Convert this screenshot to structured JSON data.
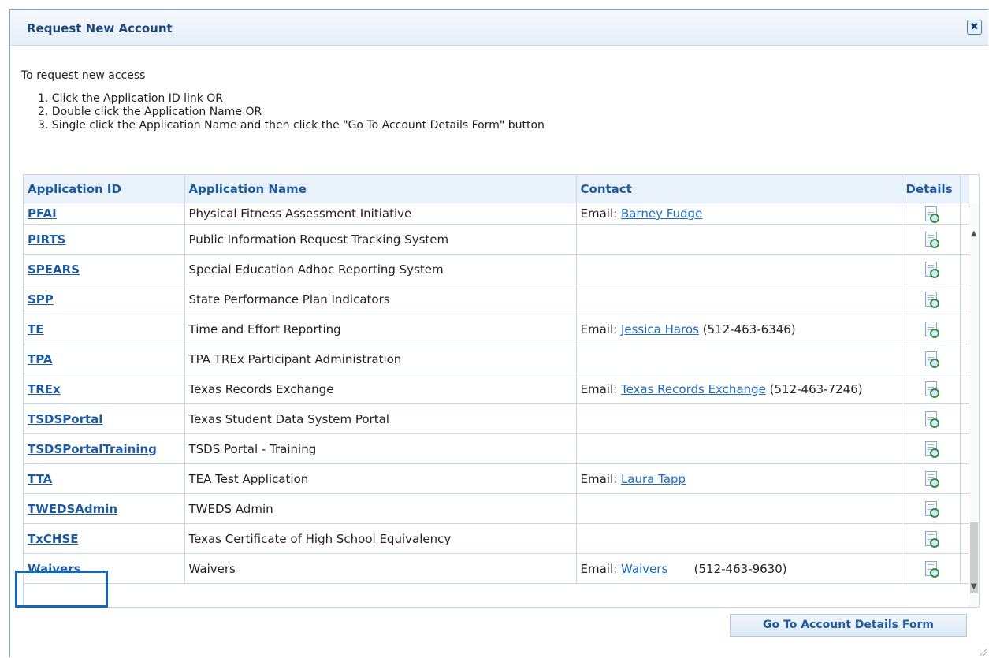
{
  "dialog": {
    "title": "Request New Account",
    "close_symbol": "✖"
  },
  "intro": "To request new access",
  "steps": [
    "1.  Click the Application ID link OR",
    "2.  Double click the Application Name OR",
    "3.  Single click the Application Name and then click the \"Go To Account Details Form\" button"
  ],
  "table": {
    "headers": [
      "Application ID",
      "Application Name",
      "Contact",
      "Details"
    ],
    "rows": [
      {
        "id": "PFAI",
        "name": "Physical Fitness Assessment Initiative",
        "contact_prefix": "Email: ",
        "contact_link": "Barney Fudge",
        "contact_suffix": ""
      },
      {
        "id": "PIRTS",
        "name": "Public Information Request Tracking System",
        "contact_prefix": "",
        "contact_link": "",
        "contact_suffix": ""
      },
      {
        "id": "SPEARS",
        "name": "Special Education Adhoc Reporting System",
        "contact_prefix": "",
        "contact_link": "",
        "contact_suffix": ""
      },
      {
        "id": "SPP",
        "name": "State Performance Plan Indicators",
        "contact_prefix": "",
        "contact_link": "",
        "contact_suffix": ""
      },
      {
        "id": "TE",
        "name": "Time and Effort Reporting",
        "contact_prefix": "Email: ",
        "contact_link": "Jessica Haros",
        "contact_suffix": " (512-463-6346)"
      },
      {
        "id": "TPA",
        "name": "TPA TREx Participant Administration",
        "contact_prefix": "",
        "contact_link": "",
        "contact_suffix": ""
      },
      {
        "id": "TREx",
        "name": "Texas Records Exchange",
        "contact_prefix": "Email: ",
        "contact_link": "Texas Records Exchange",
        "contact_suffix": " (512-463-7246)"
      },
      {
        "id": "TSDSPortal",
        "name": "Texas Student Data System Portal",
        "contact_prefix": "",
        "contact_link": "",
        "contact_suffix": ""
      },
      {
        "id": "TSDSPortalTraining",
        "name": "TSDS Portal - Training",
        "contact_prefix": "",
        "contact_link": "",
        "contact_suffix": ""
      },
      {
        "id": "TTA",
        "name": "TEA Test Application",
        "contact_prefix": "Email: ",
        "contact_link": "Laura Tapp",
        "contact_suffix": ""
      },
      {
        "id": "TWEDSAdmin",
        "name": "TWEDS Admin",
        "contact_prefix": "",
        "contact_link": "",
        "contact_suffix": ""
      },
      {
        "id": "TxCHSE",
        "name": "Texas Certificate of High School Equivalency",
        "contact_prefix": "",
        "contact_link": "",
        "contact_suffix": ""
      },
      {
        "id": "Waivers",
        "name": "Waivers",
        "contact_prefix": "Email: ",
        "contact_link": "Waivers",
        "contact_suffix": "       (512-463-9630)"
      }
    ]
  },
  "goto_button": "Go To Account Details Form",
  "icons": {
    "details": "document-magnifier-icon",
    "close": "close-icon"
  }
}
